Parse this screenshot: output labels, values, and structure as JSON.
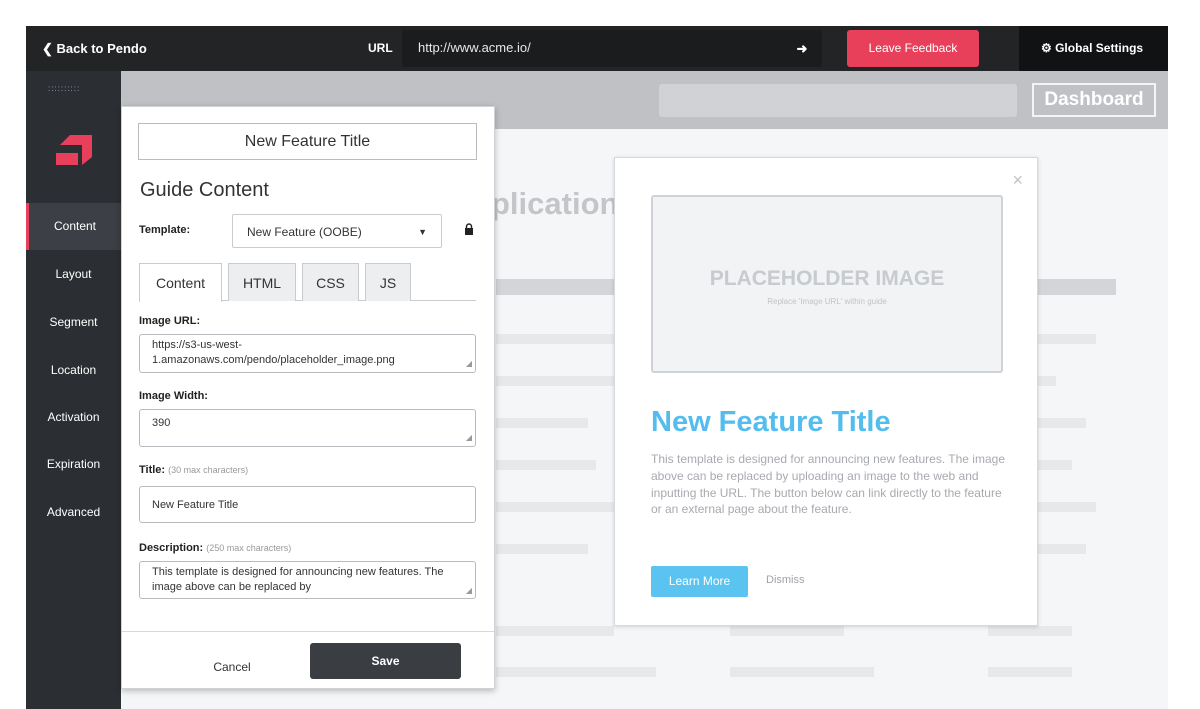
{
  "topbar": {
    "back_label": "Back to Pendo",
    "url_label": "URL",
    "url_value": "http://www.acme.io/",
    "go_icon": "arrow-right-icon",
    "feedback_label": "Leave Feedback",
    "settings_label": "Global Settings",
    "settings_icon": "gear-icon"
  },
  "sidebar": {
    "grip": "::::::::::",
    "items": [
      {
        "label": "Content"
      },
      {
        "label": "Layout"
      },
      {
        "label": "Segment"
      },
      {
        "label": "Location"
      },
      {
        "label": "Activation"
      },
      {
        "label": "Expiration"
      },
      {
        "label": "Advanced"
      }
    ],
    "accent": "#e8405b"
  },
  "app": {
    "dashboard_label": "Dashboard",
    "title_fragment": "plication"
  },
  "editor": {
    "title_value": "New Feature Title",
    "heading": "Guide Content",
    "template_label": "Template:",
    "template_value": "New Feature (OOBE)",
    "tabs": [
      "Content",
      "HTML",
      "CSS",
      "JS"
    ],
    "image_url_label": "Image URL:",
    "image_url_value": "https://s3-us-west-1.amazonaws.com/pendo/placeholder_image.png",
    "image_width_label": "Image Width:",
    "image_width_value": "390",
    "title_label": "Title:",
    "title_hint": "(30 max characters)",
    "title_field_value": "New Feature Title",
    "description_label": "Description:",
    "description_hint": "(250 max characters)",
    "description_value": "This template is designed for announcing new features. The image above can be replaced by",
    "cancel_label": "Cancel",
    "save_label": "Save"
  },
  "guide": {
    "close_glyph": "×",
    "placeholder_title": "PLACEHOLDER IMAGE",
    "placeholder_sub": "Replace 'Image URL' within guide",
    "title": "New Feature Title",
    "description": "This template is designed for announcing new features. The image above can be replaced by uploading an image to the web and inputting the URL. The button below can link directly to the feature or an external page about the feature.",
    "learn_more_label": "Learn More",
    "dismiss_label": "Dismiss",
    "accent": "#54bdee"
  }
}
